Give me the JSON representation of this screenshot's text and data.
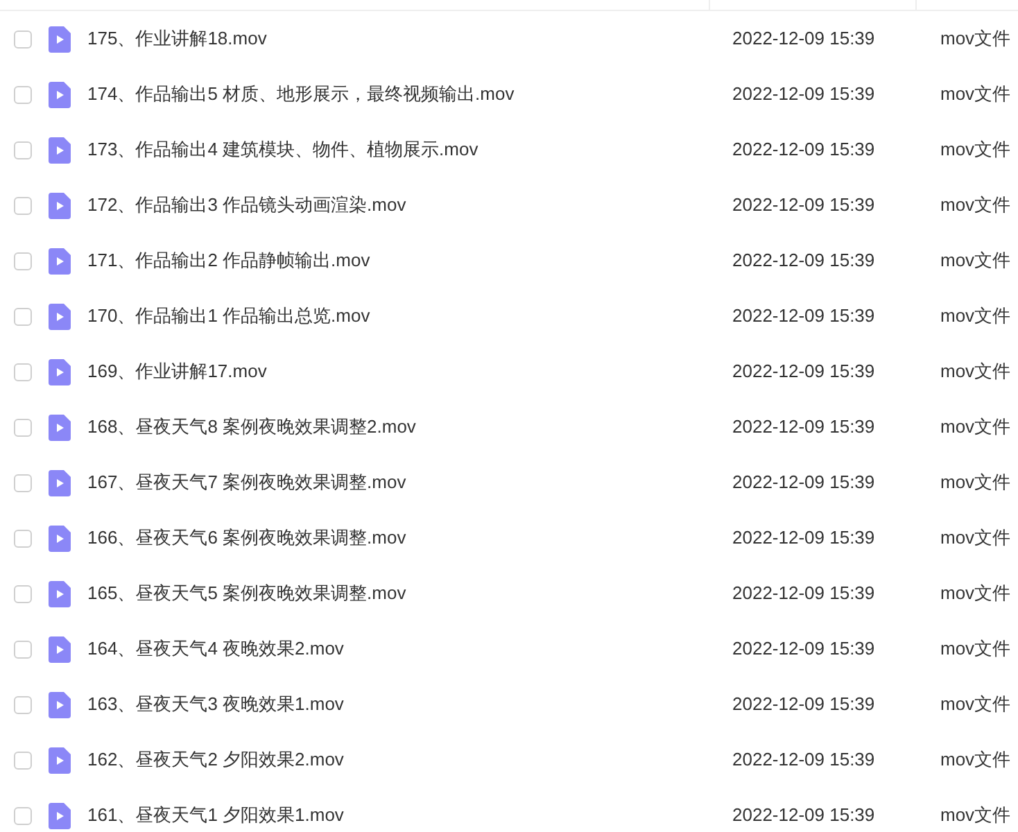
{
  "files": [
    {
      "name": "175、作业讲解18.mov",
      "modified": "2022-12-09 15:39",
      "type": "mov文件",
      "checked": false
    },
    {
      "name": "174、作品输出5 材质、地形展示，最终视频输出.mov",
      "modified": "2022-12-09 15:39",
      "type": "mov文件",
      "checked": false
    },
    {
      "name": "173、作品输出4 建筑模块、物件、植物展示.mov",
      "modified": "2022-12-09 15:39",
      "type": "mov文件",
      "checked": false
    },
    {
      "name": "172、作品输出3 作品镜头动画渲染.mov",
      "modified": "2022-12-09 15:39",
      "type": "mov文件",
      "checked": false
    },
    {
      "name": "171、作品输出2 作品静帧输出.mov",
      "modified": "2022-12-09 15:39",
      "type": "mov文件",
      "checked": false
    },
    {
      "name": "170、作品输出1 作品输出总览.mov",
      "modified": "2022-12-09 15:39",
      "type": "mov文件",
      "checked": false
    },
    {
      "name": "169、作业讲解17.mov",
      "modified": "2022-12-09 15:39",
      "type": "mov文件",
      "checked": false
    },
    {
      "name": "168、昼夜天气8 案例夜晚效果调整2.mov",
      "modified": "2022-12-09 15:39",
      "type": "mov文件",
      "checked": false
    },
    {
      "name": "167、昼夜天气7 案例夜晚效果调整.mov",
      "modified": "2022-12-09 15:39",
      "type": "mov文件",
      "checked": false
    },
    {
      "name": "166、昼夜天气6 案例夜晚效果调整.mov",
      "modified": "2022-12-09 15:39",
      "type": "mov文件",
      "checked": false
    },
    {
      "name": "165、昼夜天气5 案例夜晚效果调整.mov",
      "modified": "2022-12-09 15:39",
      "type": "mov文件",
      "checked": false
    },
    {
      "name": "164、昼夜天气4 夜晚效果2.mov",
      "modified": "2022-12-09 15:39",
      "type": "mov文件",
      "checked": false
    },
    {
      "name": "163、昼夜天气3 夜晚效果1.mov",
      "modified": "2022-12-09 15:39",
      "type": "mov文件",
      "checked": false
    },
    {
      "name": "162、昼夜天气2 夕阳效果2.mov",
      "modified": "2022-12-09 15:39",
      "type": "mov文件",
      "checked": false
    },
    {
      "name": "161、昼夜天气1 夕阳效果1.mov",
      "modified": "2022-12-09 15:39",
      "type": "mov文件",
      "checked": false
    }
  ]
}
